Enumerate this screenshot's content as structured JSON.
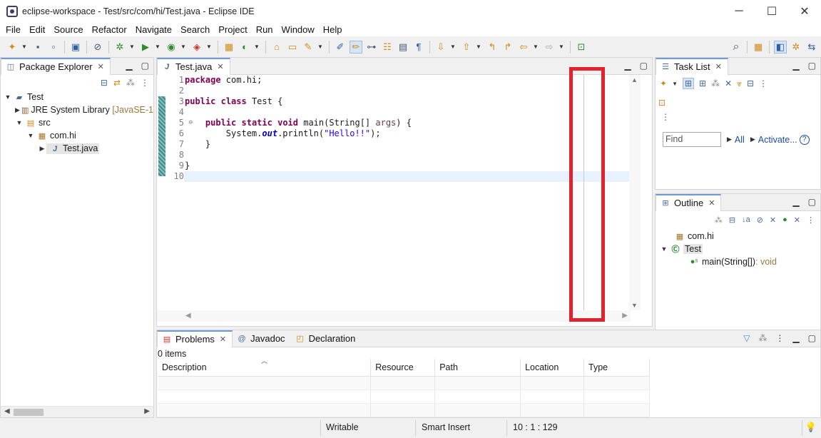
{
  "window": {
    "title": "eclipse-workspace - Test/src/com/hi/Test.java - Eclipse IDE",
    "controls": [
      "─",
      "☐",
      "✕"
    ]
  },
  "menu": [
    "File",
    "Edit",
    "Source",
    "Refactor",
    "Navigate",
    "Search",
    "Project",
    "Run",
    "Window",
    "Help"
  ],
  "package_explorer": {
    "tab_label": "Package Explorer",
    "tree": {
      "project": "Test",
      "jre": "JRE System Library",
      "jre_suffix": "[JavaSE-1",
      "src": "src",
      "package": "com.hi",
      "file": "Test.java"
    }
  },
  "editor": {
    "tab_label": "Test.java",
    "line_numbers": [
      "1",
      "2",
      "3",
      "4",
      "5",
      "6",
      "7",
      "8",
      "9",
      "10"
    ],
    "code": {
      "l1_kw": "package",
      "l1_rest": " com.hi;",
      "l3_kw1": "public",
      "l3_kw2": "class",
      "l3_rest": " Test {",
      "l5_indent": "    ",
      "l5_kw1": "public",
      "l5_kw2": "static",
      "l5_kw3": "void",
      "l5_rest1": " main(String[] ",
      "l5_param": "args",
      "l5_rest2": ") {",
      "l6_a": "        System.",
      "l6_field": "out",
      "l6_b": ".println(",
      "l6_str": "\"Hello!!\"",
      "l6_c": ");",
      "l7": "    }",
      "l9": "}"
    }
  },
  "task_list": {
    "tab_label": "Task List",
    "find_placeholder": "Find",
    "all_label": "All",
    "activate_label": "Activate...",
    "help": "?"
  },
  "outline": {
    "tab_label": "Outline",
    "package": "com.hi",
    "class": "Test",
    "method": "main(String[])",
    "method_return": " : void"
  },
  "problems": {
    "tabs": [
      "Problems",
      "Javadoc",
      "Declaration"
    ],
    "count": "0 items",
    "columns": [
      "Description",
      "Resource",
      "Path",
      "Location",
      "Type"
    ]
  },
  "status": {
    "writable": "Writable",
    "insert_mode": "Smart Insert",
    "position": "10 : 1 : 129"
  },
  "colors": {
    "highlight_box": "#e0232d",
    "keyword": "#7f0055",
    "string": "#2a00ff"
  }
}
